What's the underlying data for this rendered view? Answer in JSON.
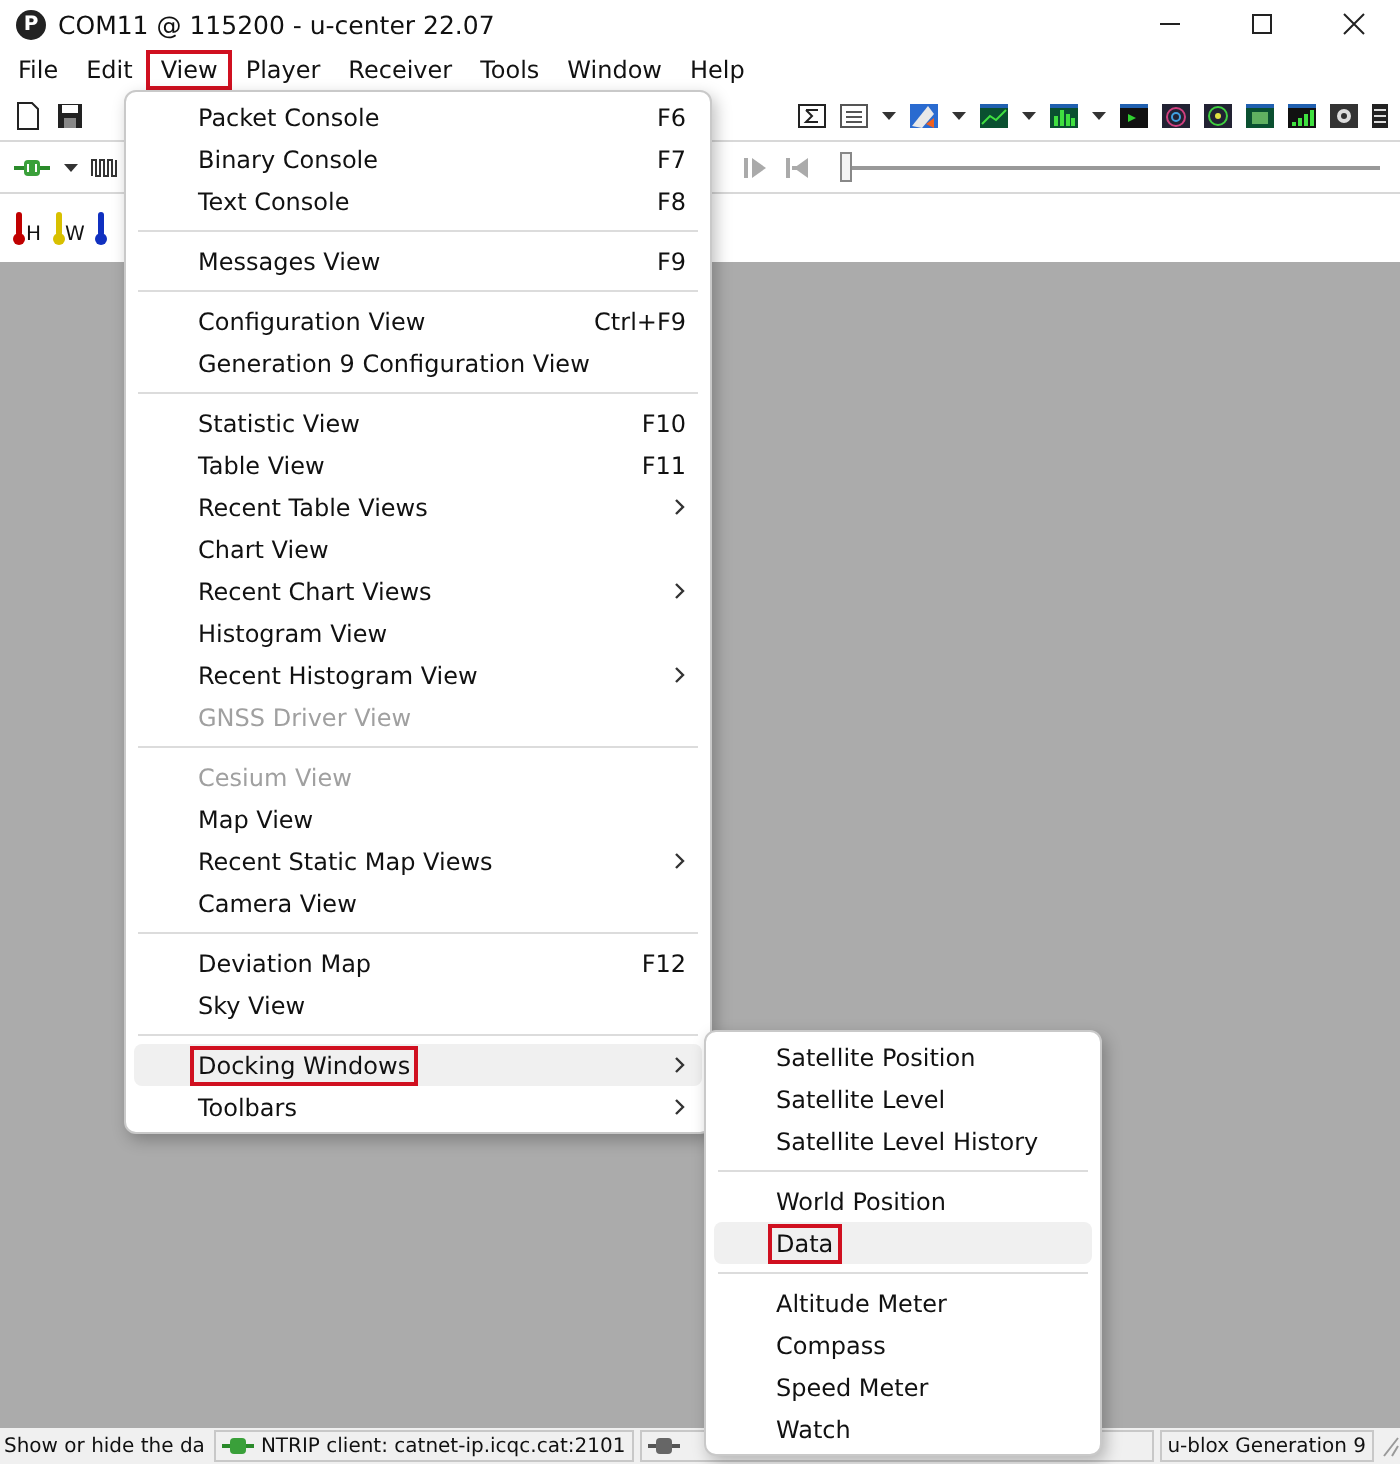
{
  "window": {
    "app_icon_letter": "P",
    "title": "COM11 @ 115200 - u-center 22.07"
  },
  "menubar": [
    {
      "label": "File",
      "marked": false
    },
    {
      "label": "Edit",
      "marked": false
    },
    {
      "label": "View",
      "marked": true
    },
    {
      "label": "Player",
      "marked": false
    },
    {
      "label": "Receiver",
      "marked": false
    },
    {
      "label": "Tools",
      "marked": false
    },
    {
      "label": "Window",
      "marked": false
    },
    {
      "label": "Help",
      "marked": false
    }
  ],
  "player": {
    "level": 0
  },
  "sensor_buttons": [
    {
      "letter": "H",
      "color": "#c00000"
    },
    {
      "letter": "W",
      "color": "#d8c000"
    },
    {
      "color": "#1030c0"
    }
  ],
  "view_menu": {
    "groups": [
      [
        {
          "label": "Packet Console",
          "shortcut": "F6",
          "submenu": false,
          "disabled": false,
          "selected": false,
          "marked": false
        },
        {
          "label": "Binary Console",
          "shortcut": "F7",
          "submenu": false,
          "disabled": false,
          "selected": false,
          "marked": false
        },
        {
          "label": "Text Console",
          "shortcut": "F8",
          "submenu": false,
          "disabled": false,
          "selected": false,
          "marked": false
        }
      ],
      [
        {
          "label": "Messages View",
          "shortcut": "F9",
          "submenu": false,
          "disabled": false,
          "selected": false,
          "marked": false
        }
      ],
      [
        {
          "label": "Configuration View",
          "shortcut": "Ctrl+F9",
          "submenu": false,
          "disabled": false,
          "selected": false,
          "marked": false
        },
        {
          "label": "Generation 9 Configuration View",
          "submenu": false,
          "disabled": false,
          "selected": false,
          "marked": false
        }
      ],
      [
        {
          "label": "Statistic View",
          "shortcut": "F10",
          "submenu": false,
          "disabled": false,
          "selected": false,
          "marked": false
        },
        {
          "label": "Table View",
          "shortcut": "F11",
          "submenu": false,
          "disabled": false,
          "selected": false,
          "marked": false
        },
        {
          "label": "Recent Table Views",
          "submenu": true,
          "disabled": false,
          "selected": false,
          "marked": false
        },
        {
          "label": "Chart View",
          "submenu": false,
          "disabled": false,
          "selected": false,
          "marked": false
        },
        {
          "label": "Recent Chart Views",
          "submenu": true,
          "disabled": false,
          "selected": false,
          "marked": false
        },
        {
          "label": "Histogram View",
          "submenu": false,
          "disabled": false,
          "selected": false,
          "marked": false
        },
        {
          "label": "Recent Histogram View",
          "submenu": true,
          "disabled": false,
          "selected": false,
          "marked": false
        },
        {
          "label": "GNSS Driver View",
          "submenu": false,
          "disabled": true,
          "selected": false,
          "marked": false
        }
      ],
      [
        {
          "label": "Cesium View",
          "submenu": false,
          "disabled": true,
          "selected": false,
          "marked": false
        },
        {
          "label": "Map View",
          "submenu": false,
          "disabled": false,
          "selected": false,
          "marked": false
        },
        {
          "label": "Recent Static Map Views",
          "submenu": true,
          "disabled": false,
          "selected": false,
          "marked": false
        },
        {
          "label": "Camera View",
          "submenu": false,
          "disabled": false,
          "selected": false,
          "marked": false
        }
      ],
      [
        {
          "label": "Deviation Map",
          "shortcut": "F12",
          "submenu": false,
          "disabled": false,
          "selected": false,
          "marked": false
        },
        {
          "label": "Sky View",
          "submenu": false,
          "disabled": false,
          "selected": false,
          "marked": false
        }
      ],
      [
        {
          "label": "Docking Windows",
          "submenu": true,
          "disabled": false,
          "selected": true,
          "marked": true
        },
        {
          "label": "Toolbars",
          "submenu": true,
          "disabled": false,
          "selected": false,
          "marked": false
        }
      ]
    ]
  },
  "docking_submenu": {
    "groups": [
      [
        {
          "label": "Satellite Position",
          "selected": false,
          "marked": false
        },
        {
          "label": "Satellite Level",
          "selected": false,
          "marked": false
        },
        {
          "label": "Satellite Level History",
          "selected": false,
          "marked": false
        }
      ],
      [
        {
          "label": "World Position",
          "selected": false,
          "marked": false
        },
        {
          "label": "Data",
          "selected": true,
          "marked": true
        }
      ],
      [
        {
          "label": "Altitude Meter",
          "selected": false,
          "marked": false
        },
        {
          "label": "Compass",
          "selected": false,
          "marked": false
        },
        {
          "label": "Speed Meter",
          "selected": false,
          "marked": false
        },
        {
          "label": "Watch",
          "selected": false,
          "marked": false
        }
      ]
    ]
  },
  "status_bar": {
    "hint": "Show or hide the da",
    "ntrip": "NTRIP client: catnet-ip.icqc.cat:2101",
    "receiver": "u-blox Generation 9"
  }
}
